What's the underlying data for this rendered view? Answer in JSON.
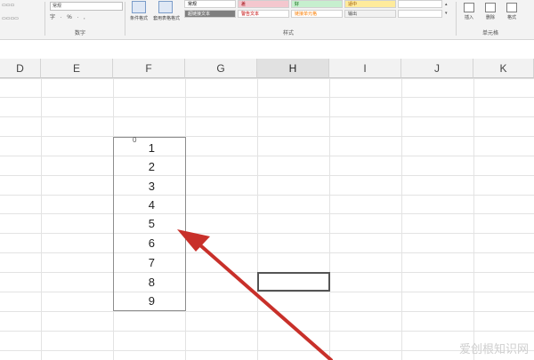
{
  "ribbon": {
    "number_group_label": "数字",
    "styles_group_label": "样式",
    "edit_group_label": "单元格",
    "number_format_value": "常规",
    "number_buttons": "字 · % · , ",
    "conditional_format_label": "条件格式",
    "table_format_label": "套用表格格式",
    "style_cells": [
      "常规",
      "差",
      "好",
      "适中",
      "超链接文本",
      "警告文本",
      "链接单元格",
      "输出"
    ],
    "insert_label": "插入",
    "delete_label": "删除",
    "format_label": "格式"
  },
  "columns": [
    "D",
    "E",
    "F",
    "G",
    "H",
    "I",
    "J",
    "K"
  ],
  "selected_column": "H",
  "cell_values": [
    "1",
    "2",
    "3",
    "4",
    "5",
    "6",
    "7",
    "8",
    "9"
  ],
  "small_marker": "0",
  "watermark": "爱创根知识网",
  "colors": {
    "arrow": "#c8302a",
    "grid": "#e3e3e3",
    "header_bg": "#f2f2f2",
    "selected_header_bg": "#e1e1e1"
  }
}
